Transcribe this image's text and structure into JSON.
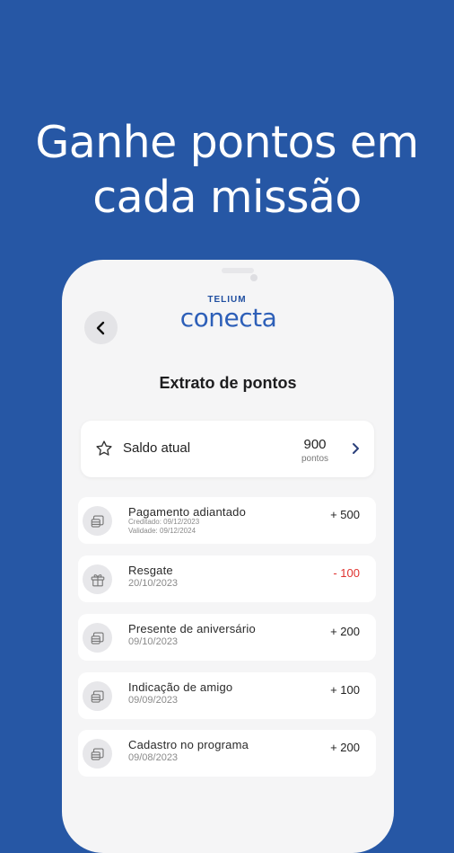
{
  "headline": {
    "line1": "Ganhe pontos em",
    "line2": "cada missão"
  },
  "app": {
    "brand_top": "TELIUM",
    "brand_main": "conecta",
    "page_title": "Extrato de pontos",
    "balance": {
      "label": "Saldo atual",
      "value": "900",
      "unit": "pontos"
    },
    "transactions": [
      {
        "name": "Pagamento adiantado",
        "line1": "Creditado: 09/12/2023",
        "line2": "Validade: 09/12/2024",
        "points": "+ 500",
        "icon": "coins-icon"
      },
      {
        "name": "Resgate",
        "date": "20/10/2023",
        "points": "- 100",
        "icon": "gift-icon"
      },
      {
        "name": "Presente de aniversário",
        "date": "09/10/2023",
        "points": "+ 200",
        "icon": "coins-icon"
      },
      {
        "name": "Indicação de amigo",
        "date": "09/09/2023",
        "points": "+ 100",
        "icon": "coins-icon"
      },
      {
        "name": "Cadastro no programa",
        "date": "09/08/2023",
        "points": "+ 200",
        "icon": "coins-icon"
      }
    ],
    "colors": {
      "background": "#2657a5",
      "brand": "#2d5fb8",
      "negative": "#e0332f"
    }
  }
}
